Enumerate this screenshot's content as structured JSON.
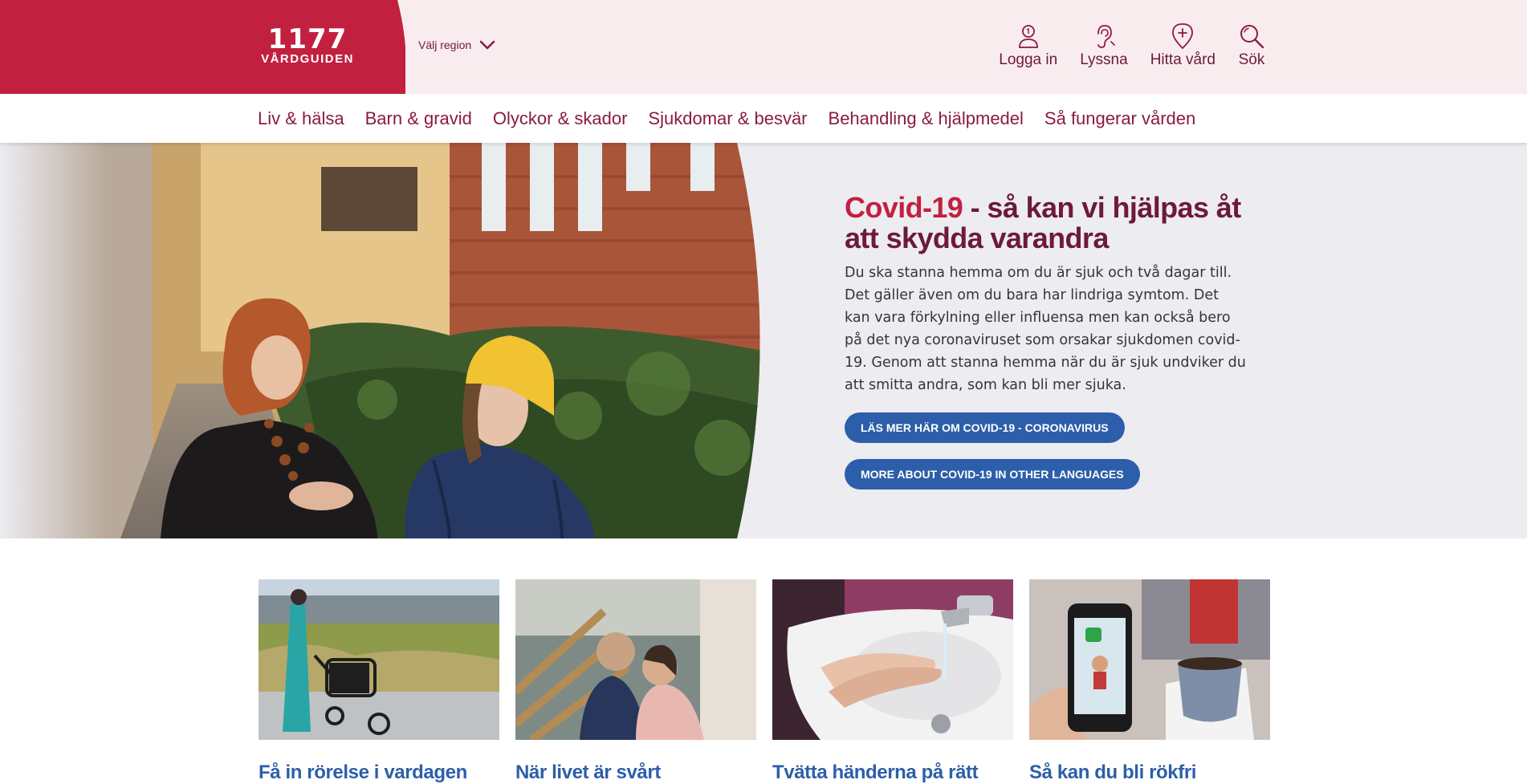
{
  "header": {
    "logo_number": "1177",
    "logo_text": "VÅRDGUIDEN",
    "region_label": "Välj region",
    "tools": [
      {
        "label": "Logga in",
        "icon": "user-icon"
      },
      {
        "label": "Lyssna",
        "icon": "ear-icon"
      },
      {
        "label": "Hitta vård",
        "icon": "location-pin-plus-icon"
      },
      {
        "label": "Sök",
        "icon": "search-icon"
      }
    ]
  },
  "nav": {
    "items": [
      "Liv & hälsa",
      "Barn & gravid",
      "Olyckor & skador",
      "Sjukdomar & besvär",
      "Behandling & hjälpmedel",
      "Så fungerar vården"
    ]
  },
  "hero": {
    "title_accent": "Covid-19",
    "title_rest": " - så kan vi hjälpas åt att skydda varandra",
    "body": "Du ska stanna hemma om du är sjuk och två dagar till. Det gäller även om du bara har lindriga symtom. Det kan vara förkylning eller influensa men kan också bero på det nya coronaviruset som orsakar sjukdomen covid-19. Genom att stanna hemma när du är sjuk undviker du att smitta andra, som kan bli mer sjuka.",
    "button_primary": "Läs mer här om covid-19 - coronavirus",
    "button_secondary": "More about covid-19 in other languages"
  },
  "cards": [
    {
      "title": "Få in rörelse i vardagen"
    },
    {
      "title": "När livet är svårt"
    },
    {
      "title": "Tvätta händerna på rätt"
    },
    {
      "title": "Så kan du bli rökfri"
    }
  ],
  "colors": {
    "brand_red": "#c2203f",
    "brand_dark": "#6d1a38",
    "header_bg": "#f9ecef",
    "hero_bg": "#edecf1",
    "button_blue": "#2d5ea9"
  }
}
